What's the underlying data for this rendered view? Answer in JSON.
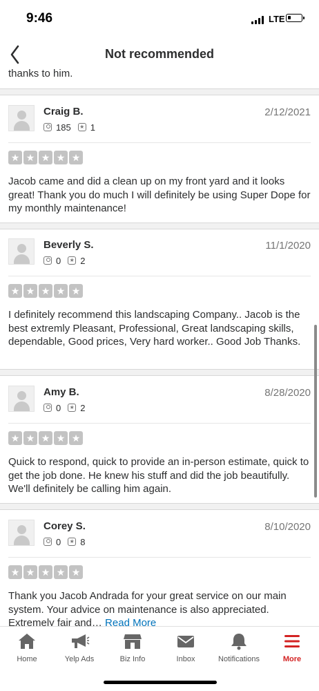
{
  "status_bar": {
    "time": "9:46",
    "network": "LTE"
  },
  "nav": {
    "title": "Not recommended"
  },
  "previous_review_tail": "thanks to him.",
  "reviews": [
    {
      "name": "Craig B.",
      "date": "2/12/2021",
      "friends": "185",
      "reviews": "1",
      "rating": 5,
      "text": "Jacob came and did a clean up on my front yard and it looks great! Thank you do much I will definitely be using Super Dope for my monthly maintenance!"
    },
    {
      "name": "Beverly S.",
      "date": "11/1/2020",
      "friends": "0",
      "reviews": "2",
      "rating": 5,
      "text": "I definitely recommend this landscaping Company..    Jacob is the best extremly Pleasant, Professional, Great landscaping skills, dependable, Good prices, Very hard worker..   Good Job Thanks."
    },
    {
      "name": "Amy B.",
      "date": "8/28/2020",
      "friends": "0",
      "reviews": "2",
      "rating": 5,
      "text": "Quick to respond, quick to provide an in-person estimate, quick to get the job done. He knew his stuff and did the job beautifully. We'll definitely be calling him again."
    },
    {
      "name": "Corey S.",
      "date": "8/10/2020",
      "friends": "0",
      "reviews": "8",
      "rating": 5,
      "text": "Thank you Jacob Andrada for your great service on our main system. Your advice on maintenance is also appreciated. Extremely fair and… ",
      "read_more": "Read More"
    }
  ],
  "tabs": [
    {
      "label": "Home",
      "icon": "home-icon",
      "active": false
    },
    {
      "label": "Yelp Ads",
      "icon": "megaphone-icon",
      "active": false
    },
    {
      "label": "Biz Info",
      "icon": "storefront-icon",
      "active": false
    },
    {
      "label": "Inbox",
      "icon": "envelope-icon",
      "active": false
    },
    {
      "label": "Notifications",
      "icon": "bell-icon",
      "active": false
    },
    {
      "label": "More",
      "icon": "menu-icon",
      "active": true
    }
  ],
  "colors": {
    "accent": "#d32323",
    "link": "#0073bb",
    "star_empty": "#c3c3c3"
  }
}
